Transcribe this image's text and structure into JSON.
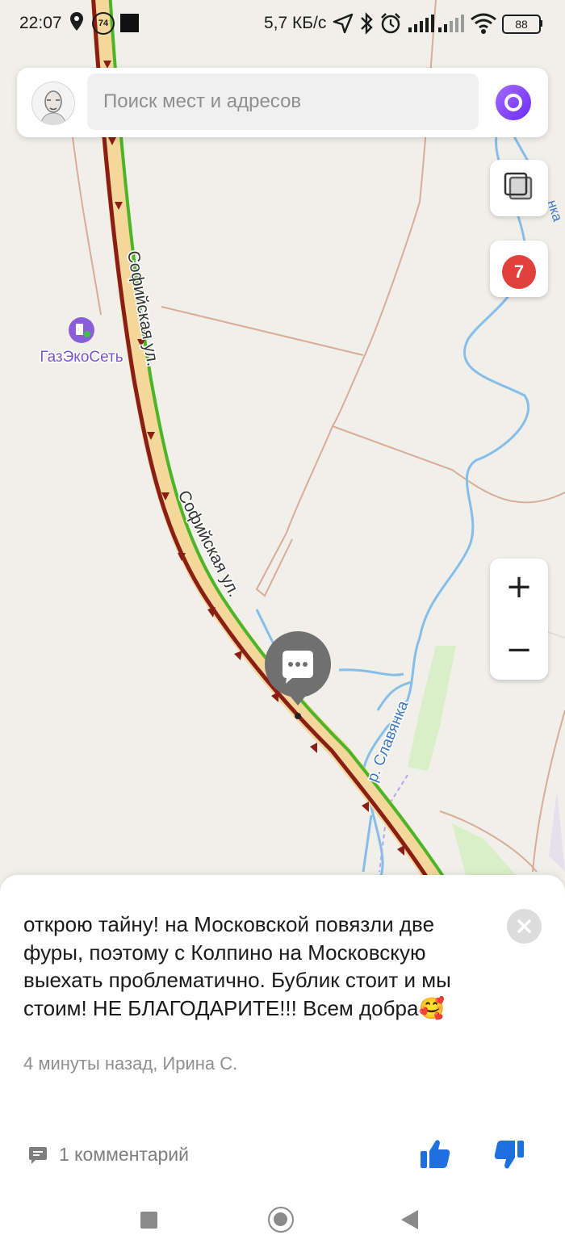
{
  "status_bar": {
    "time": "22:07",
    "notification_count": "74",
    "network_speed": "5,7 КБ/с",
    "battery": "88"
  },
  "search": {
    "placeholder": "Поиск мест и адресов"
  },
  "map": {
    "street_label_1": "Софийская ул.",
    "street_label_2": "Софийская ул.",
    "poi_name": "ГазЭкоСеть",
    "river_label": "р. Славянка",
    "river_label_2": "нка"
  },
  "map_controls": {
    "traffic_level": "7",
    "zoom_in": "+",
    "zoom_out": "−"
  },
  "event_card": {
    "message": "открою тайну! на Московской повязли две фуры, поэтому с Колпино на Московскую выехать проблематично. Бублик стоит и мы стоим! НЕ БЛАГОДАРИТЕ!!! Всем добра",
    "emoji": "🥰",
    "meta": "4 минуты назад, Ирина С.",
    "comments_label": "1 комментарий"
  },
  "colors": {
    "traffic_red": "#8b1e14",
    "traffic_green": "#4cb527",
    "road_fill": "#f6dba0",
    "river": "#7ab5e6",
    "badge": "#e2403a",
    "like_blue": "#1e6fe0"
  }
}
